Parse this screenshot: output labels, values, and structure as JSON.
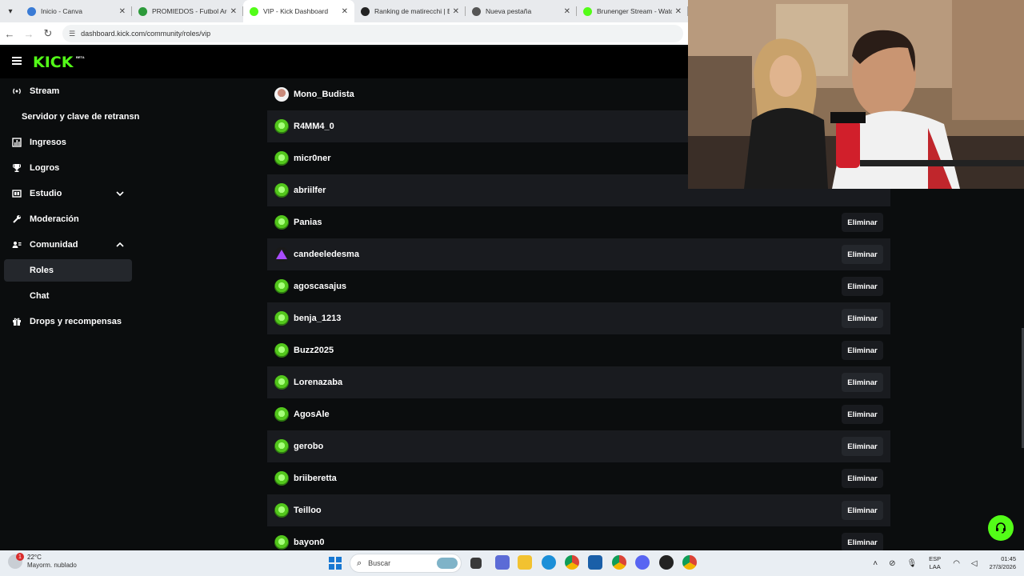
{
  "browser": {
    "tabs": [
      {
        "title": "Inicio - Canva",
        "favicon_color": "#3a7bd5",
        "active": false
      },
      {
        "title": "PROMIEDOS - Futbol Arg",
        "favicon_color": "#2c9a3a",
        "active": false
      },
      {
        "title": "VIP - Kick Dashboard",
        "favicon_color": "#53fc18",
        "active": true
      },
      {
        "title": "Ranking de matirecchi | El",
        "favicon_color": "#222222",
        "active": false
      },
      {
        "title": "Nueva pestaña",
        "favicon_color": "#555555",
        "active": false
      },
      {
        "title": "Brunenger Stream - Watc",
        "favicon_color": "#53fc18",
        "active": false
      }
    ],
    "url": "dashboard.kick.com/community/roles/vip"
  },
  "header": {
    "logo": "KICK",
    "logo_badge": "BETA"
  },
  "sidebar": {
    "items": [
      {
        "label": "Stream",
        "icon": "broadcast-icon"
      },
      {
        "label": "Servidor y clave de retransn",
        "icon": ""
      },
      {
        "label": "Ingresos",
        "icon": "chart-icon"
      },
      {
        "label": "Logros",
        "icon": "trophy-icon"
      },
      {
        "label": "Estudio",
        "icon": "studio-icon"
      },
      {
        "label": "Moderación",
        "icon": "wrench-icon"
      },
      {
        "label": "Comunidad",
        "icon": "community-icon"
      },
      {
        "label": "Roles",
        "icon": ""
      },
      {
        "label": "Chat",
        "icon": ""
      },
      {
        "label": "Drops y recompensas",
        "icon": "gift-icon"
      }
    ]
  },
  "vip_list": {
    "remove_label": "Eliminar",
    "users": [
      {
        "name": "Mono_Budista",
        "avatar": "photo"
      },
      {
        "name": "R4MM4_0",
        "avatar": "green"
      },
      {
        "name": "micr0ner",
        "avatar": "green"
      },
      {
        "name": "abriilfer",
        "avatar": "green"
      },
      {
        "name": "Panias",
        "avatar": "green"
      },
      {
        "name": "candeeledesma",
        "avatar": "purple"
      },
      {
        "name": "agoscasajus",
        "avatar": "green"
      },
      {
        "name": "benja_1213",
        "avatar": "green"
      },
      {
        "name": "Buzz2025",
        "avatar": "green"
      },
      {
        "name": "Lorenazaba",
        "avatar": "green"
      },
      {
        "name": "AgosAle",
        "avatar": "green"
      },
      {
        "name": "gerobo",
        "avatar": "green"
      },
      {
        "name": "briiberetta",
        "avatar": "green"
      },
      {
        "name": "Teilloo",
        "avatar": "green"
      },
      {
        "name": "bayon0",
        "avatar": "green"
      }
    ]
  },
  "taskbar": {
    "weather_temp": "22°C",
    "weather_cond": "Mayorm. nublado",
    "weather_badge": "1",
    "search_placeholder": "Buscar",
    "lang_1": "ESP",
    "lang_2": "LAA",
    "time": "01:45",
    "date": "27/3/2026"
  }
}
